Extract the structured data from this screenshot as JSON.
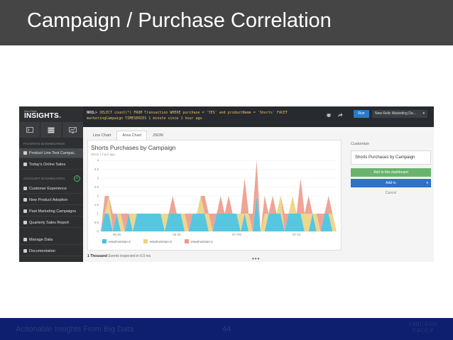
{
  "slide": {
    "title": "Campaign / Purchase Correlation"
  },
  "app": {
    "logo_small": "New Relic",
    "logo_big": "INSIGHTS",
    "logo_beta": "Beta",
    "icons": [
      "terminal-icon",
      "database-icon",
      "dashboard-icon"
    ],
    "favorites_heading": "FAVORITE DASHBOARDS",
    "favorites": [
      {
        "label": "Product Line Test Campai..",
        "icon": "user-icon"
      },
      {
        "label": "Today's Online Sales",
        "icon": "flag-icon"
      }
    ],
    "account_heading": "ACCOUNT DASHBOARDS",
    "account_items": [
      {
        "label": "Customer Experience",
        "icon": "trophy-icon"
      },
      {
        "label": "New Product Adoption",
        "icon": "rocket-icon"
      },
      {
        "label": "Past Marketing Campaigns",
        "icon": "briefcase-icon"
      },
      {
        "label": "Quarterly Sales Report",
        "icon": "dollar-icon"
      }
    ],
    "bottom_items": [
      {
        "label": "Manage Data",
        "icon": "gear-icon"
      },
      {
        "label": "Documentation",
        "icon": "book-icon"
      }
    ]
  },
  "query": {
    "prompt": "NRQL>",
    "line1": "SELECT count(*) FROM Transaction WHERE purchase = 'YES' and productName = 'Shorts' FACET",
    "line2": "marketingCampaign TIMESERIES 1 minute since 1 hour ago",
    "run_label": "Run",
    "dashboard_select": "New Relic Marketing Da..."
  },
  "tabs": [
    "Line Chart",
    "Area Chart",
    "JSON"
  ],
  "active_tab": 1,
  "chart_data": {
    "type": "area",
    "title": "Shorts Purchases by Campaign",
    "subtitle": "Since 1 hour ago",
    "ylim": [
      0,
      4
    ],
    "yticks": [
      "0",
      "0.5",
      "1",
      "1.5",
      "2",
      "2.5",
      "3",
      "3.5",
      "4"
    ],
    "xticks": [
      {
        "label": "06:30",
        "index": 4
      },
      {
        "label": "06:45",
        "index": 19
      },
      {
        "label": "07 PM",
        "index": 34
      },
      {
        "label": "07:15",
        "index": 49
      }
    ],
    "x": [
      0,
      1,
      2,
      3,
      4,
      5,
      6,
      7,
      8,
      9,
      10,
      11,
      12,
      13,
      14,
      15,
      16,
      17,
      18,
      19,
      20,
      21,
      22,
      23,
      24,
      25,
      26,
      27,
      28,
      29,
      30,
      31,
      32,
      33,
      34,
      35,
      36,
      37,
      38,
      39,
      40,
      41,
      42,
      43,
      44,
      45,
      46,
      47,
      48,
      49,
      50,
      51,
      52,
      53,
      54,
      55,
      56,
      57,
      58,
      59
    ],
    "series": [
      {
        "name": "email-version-2",
        "color": "#45c1de",
        "values": [
          0,
          1,
          1,
          0,
          1,
          0,
          0,
          1,
          0,
          1,
          1,
          1,
          1,
          1,
          1,
          1,
          0,
          1,
          1,
          1,
          1,
          0,
          0,
          1,
          1,
          1,
          1,
          0,
          0,
          1,
          1,
          1,
          1,
          1,
          1,
          0,
          1,
          0,
          0,
          2,
          0,
          0,
          1,
          1,
          1,
          1,
          0,
          1,
          1,
          1,
          1,
          0,
          0,
          1,
          0,
          0,
          1,
          1,
          0,
          0
        ]
      },
      {
        "name": "email-version-3",
        "color": "#ecd37e",
        "values": [
          0,
          0,
          1,
          0,
          0,
          1,
          0,
          0,
          1,
          0,
          0,
          0,
          0,
          0,
          0,
          0,
          1,
          0,
          0,
          0,
          0,
          1,
          0,
          0,
          0,
          1,
          0,
          1,
          0,
          0,
          0,
          0,
          0,
          0,
          0,
          1,
          0,
          1,
          0,
          0,
          0,
          1,
          0,
          0,
          0,
          1,
          0,
          0,
          1,
          0,
          0,
          1,
          1,
          0,
          1,
          0,
          0,
          0,
          1,
          0
        ]
      },
      {
        "name": "email-version-1",
        "color": "#ec9a8a",
        "values": [
          0,
          1,
          0,
          1,
          0,
          0,
          1,
          0,
          0,
          0,
          0,
          0,
          0,
          0,
          0,
          0,
          0,
          0,
          1,
          0,
          0,
          0,
          1,
          0,
          0,
          0,
          1,
          0,
          1,
          0,
          1,
          0,
          1,
          0,
          0,
          0,
          2,
          0,
          1,
          2,
          0,
          1,
          0,
          1,
          0,
          0,
          1,
          0,
          0,
          0,
          2,
          0,
          1,
          0,
          0,
          1,
          0,
          1,
          0,
          0
        ]
      }
    ]
  },
  "status": {
    "count": "1 Thousand",
    "rest": "Events inspected in 6.0 ms"
  },
  "customize": {
    "label": "Customize",
    "title_value": "Shorts Purchases by Campaign",
    "add_dashboard": "Add to this dashboard",
    "add_to": "Add to",
    "cancel": "Cancel"
  },
  "footer": {
    "left": "Actionable Insights From Big Data",
    "page": "44",
    "logo_line1": "CHICAGO",
    "logo_line2": "GROUP"
  }
}
